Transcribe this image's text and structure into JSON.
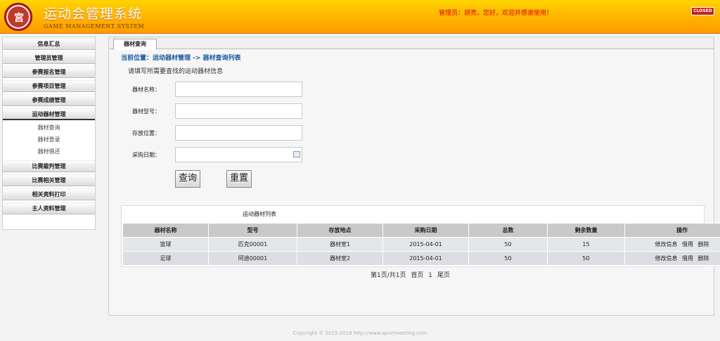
{
  "header": {
    "title": "运动会管理系统",
    "subtitle": "GAME MANAGEMENT SYSTEM",
    "welcome": "管理员：胡亮，您好，欢迎并感谢使用！",
    "closed_label": "CLOSED"
  },
  "sidebar": {
    "items": [
      {
        "label": "信息汇总"
      },
      {
        "label": "管理员管理"
      },
      {
        "label": "参赛报名管理"
      },
      {
        "label": "参赛项目管理"
      },
      {
        "label": "参赛成绩管理"
      },
      {
        "label": "运动器材管理"
      },
      {
        "label": "比赛裁判管理"
      },
      {
        "label": "比赛相关管理"
      },
      {
        "label": "相关资料打印"
      },
      {
        "label": "主人资料管理"
      }
    ],
    "submenu": [
      {
        "label": "器材查询"
      },
      {
        "label": "器材登录"
      },
      {
        "label": "器材借还"
      }
    ]
  },
  "main": {
    "tab_label": "器材查询",
    "breadcrumb": "当前位置：运动器材管理 -> 器材查询列表",
    "hint": "请填写所需要查找的运动器材信息",
    "form": {
      "name_label": "器材名称：",
      "name_value": "",
      "model_label": "器材型号：",
      "model_value": "",
      "location_label": "存放位置：",
      "location_value": "",
      "date_label": "采购日期：",
      "date_value": ""
    },
    "search_button": "查询",
    "reset_button": "重置",
    "list": {
      "title": "运动器材列表",
      "columns": [
        "器材名称",
        "型号",
        "存放地点",
        "采购日期",
        "总数",
        "剩余数量",
        "操作"
      ],
      "rows": [
        {
          "name": "篮球",
          "model": "匹克00001",
          "location": "器材室1",
          "date": "2015-04-01",
          "total": "50",
          "remaining": "15"
        },
        {
          "name": "足球",
          "model": "阿迪00001",
          "location": "器材室2",
          "date": "2015-04-01",
          "total": "50",
          "remaining": "50"
        }
      ],
      "actions": {
        "edit": "修改信息",
        "borrow": "借用",
        "delete": "删除"
      }
    },
    "pager": {
      "status": "第1页/共1页",
      "first": "首页",
      "page": "1",
      "last": "尾页"
    }
  },
  "footer": {
    "copyright": "Copyright © 2015-2016 http://www.sportmeeting.com"
  },
  "colors": {
    "header_top": "#ffd400",
    "header_bottom": "#ff9a00",
    "breadcrumb": "#1a5aa0",
    "welcome": "#dd0000",
    "closed": "#c81d1d"
  }
}
